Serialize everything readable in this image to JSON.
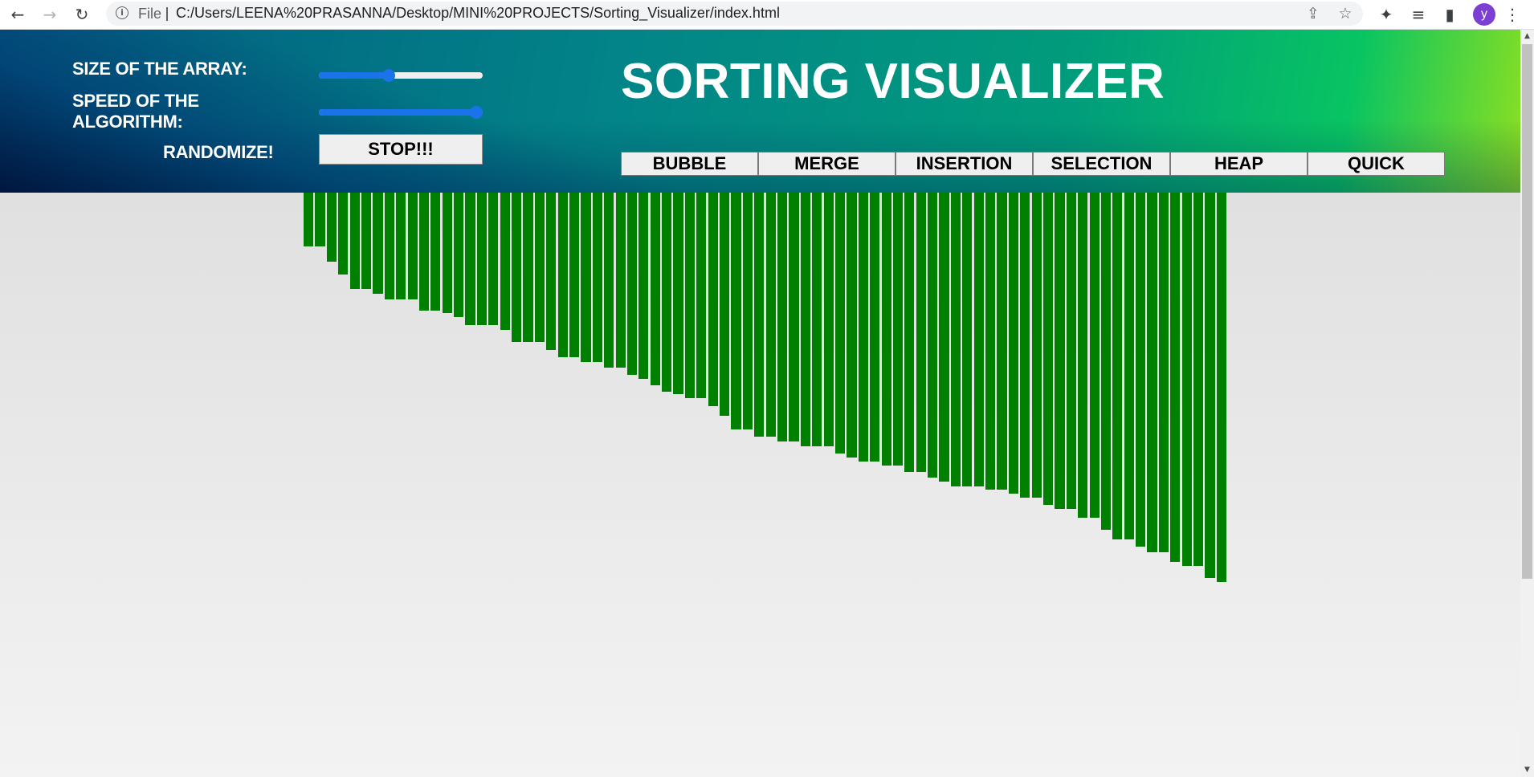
{
  "browser": {
    "back_icon": "←",
    "forward_icon": "→",
    "reload_icon": "↻",
    "info_icon": "i",
    "scheme_label": "File",
    "url": "C:/Users/LEENA%20PRASANNA/Desktop/MINI%20PROJECTS/Sorting_Visualizer/index.html",
    "share_icon": "⇪",
    "bookmark_icon": "☆",
    "extensions_icon": "✦",
    "media_icon": "≡",
    "sidepanel_icon": "▮",
    "profile_initial": "y",
    "menu_icon": "⋮"
  },
  "controls": {
    "size_label": "SIZE OF THE ARRAY:",
    "speed_label": "SPEED OF THE ALGORITHM:",
    "randomize_label": "RANDOMIZE!",
    "size_slider_fraction": 0.42,
    "speed_slider_fraction": 1.0,
    "stop_label": "STOP!!!"
  },
  "header": {
    "title": "SORTING VISUALIZER"
  },
  "algorithms": [
    "BUBBLE",
    "MERGE",
    "INSERTION",
    "SELECTION",
    "HEAP",
    "QUICK"
  ],
  "colors": {
    "bar": "#008000",
    "slider_accent": "#1a73e8",
    "profile_avatar": "#7b3fd3"
  },
  "array": {
    "count": 80,
    "values": [
      67,
      67,
      86,
      102,
      120,
      120,
      126,
      133,
      133,
      133,
      147,
      147,
      150,
      155,
      165,
      165,
      165,
      171,
      186,
      186,
      186,
      196,
      205,
      205,
      211,
      211,
      218,
      218,
      227,
      232,
      240,
      248,
      251,
      256,
      256,
      266,
      278,
      295,
      295,
      304,
      304,
      310,
      310,
      316,
      316,
      316,
      325,
      330,
      335,
      335,
      340,
      340,
      348,
      348,
      355,
      360,
      366,
      366,
      366,
      370,
      370,
      375,
      380,
      380,
      389,
      394,
      394,
      405,
      405,
      420,
      432,
      432,
      441,
      448,
      448,
      460,
      465,
      465,
      480,
      485
    ]
  }
}
